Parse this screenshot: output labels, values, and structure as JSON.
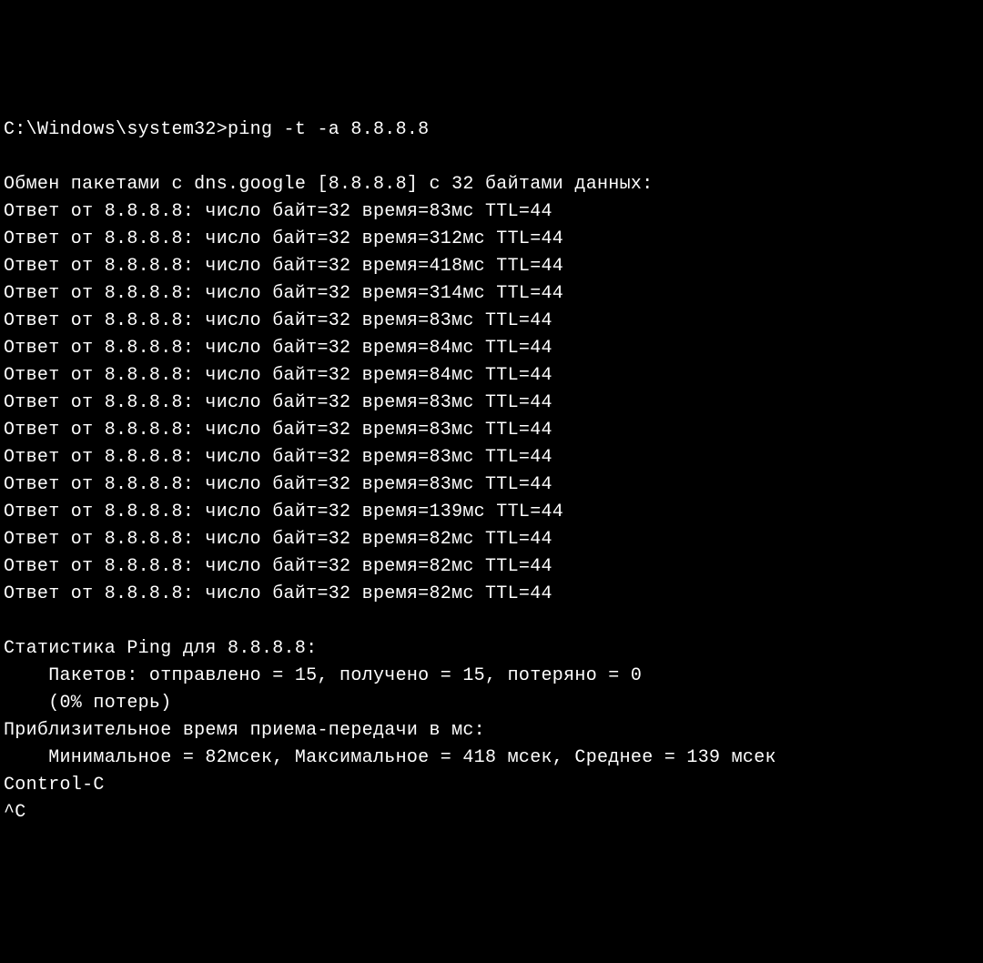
{
  "prompt": {
    "path": "C:\\Windows\\system32>",
    "command": "ping -t -a 8.8.8.8"
  },
  "header": "Обмен пакетами с dns.google [8.8.8.8] с 32 байтами данных:",
  "replies": [
    "Ответ от 8.8.8.8: число байт=32 время=83мс TTL=44",
    "Ответ от 8.8.8.8: число байт=32 время=312мс TTL=44",
    "Ответ от 8.8.8.8: число байт=32 время=418мс TTL=44",
    "Ответ от 8.8.8.8: число байт=32 время=314мс TTL=44",
    "Ответ от 8.8.8.8: число байт=32 время=83мс TTL=44",
    "Ответ от 8.8.8.8: число байт=32 время=84мс TTL=44",
    "Ответ от 8.8.8.8: число байт=32 время=84мс TTL=44",
    "Ответ от 8.8.8.8: число байт=32 время=83мс TTL=44",
    "Ответ от 8.8.8.8: число байт=32 время=83мс TTL=44",
    "Ответ от 8.8.8.8: число байт=32 время=83мс TTL=44",
    "Ответ от 8.8.8.8: число байт=32 время=83мс TTL=44",
    "Ответ от 8.8.8.8: число байт=32 время=139мс TTL=44",
    "Ответ от 8.8.8.8: число байт=32 время=82мс TTL=44",
    "Ответ от 8.8.8.8: число байт=32 время=82мс TTL=44",
    "Ответ от 8.8.8.8: число байт=32 время=82мс TTL=44"
  ],
  "blank": " ",
  "stats_header": "Статистика Ping для 8.8.8.8:",
  "stats_packets": "    Пакетов: отправлено = 15, получено = 15, потеряно = 0",
  "stats_loss": "    (0% потерь)",
  "rtt_header": "Приблизительное время приема-передачи в мс:",
  "rtt_values": "    Минимальное = 82мсек, Максимальное = 418 мсек, Среднее = 139 мсек",
  "ctrl_c": "Control-C",
  "caret_c": "^C"
}
